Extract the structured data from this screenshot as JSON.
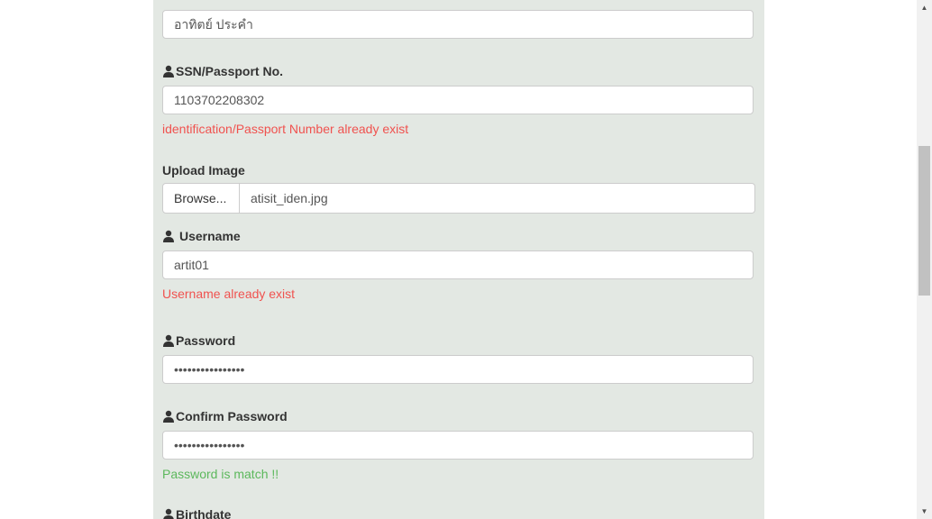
{
  "form": {
    "name_value": "อาทิตย์ ประคำ",
    "ssn": {
      "label": "SSN/Passport No.",
      "value": "1103702208302",
      "error": "identification/Passport Number already exist"
    },
    "upload": {
      "label": "Upload Image",
      "browse_label": "Browse...",
      "file_name": "atisit_iden.jpg"
    },
    "username": {
      "label": "Username",
      "value": "artit01",
      "error": "Username already exist"
    },
    "password": {
      "label": "Password",
      "value": "••••••••••••••••"
    },
    "confirm_password": {
      "label": "Confirm Password",
      "value": "••••••••••••••••",
      "success": "Password is match !!"
    },
    "birthdate": {
      "label": "Birthdate"
    }
  },
  "colors": {
    "panel_bg": "#e3e8e3",
    "error": "#f0524f",
    "success": "#5cb85c"
  },
  "icons": {
    "field_icon": "user-icon",
    "scroll_up": "arrow-up-icon",
    "scroll_down": "arrow-down-icon"
  }
}
